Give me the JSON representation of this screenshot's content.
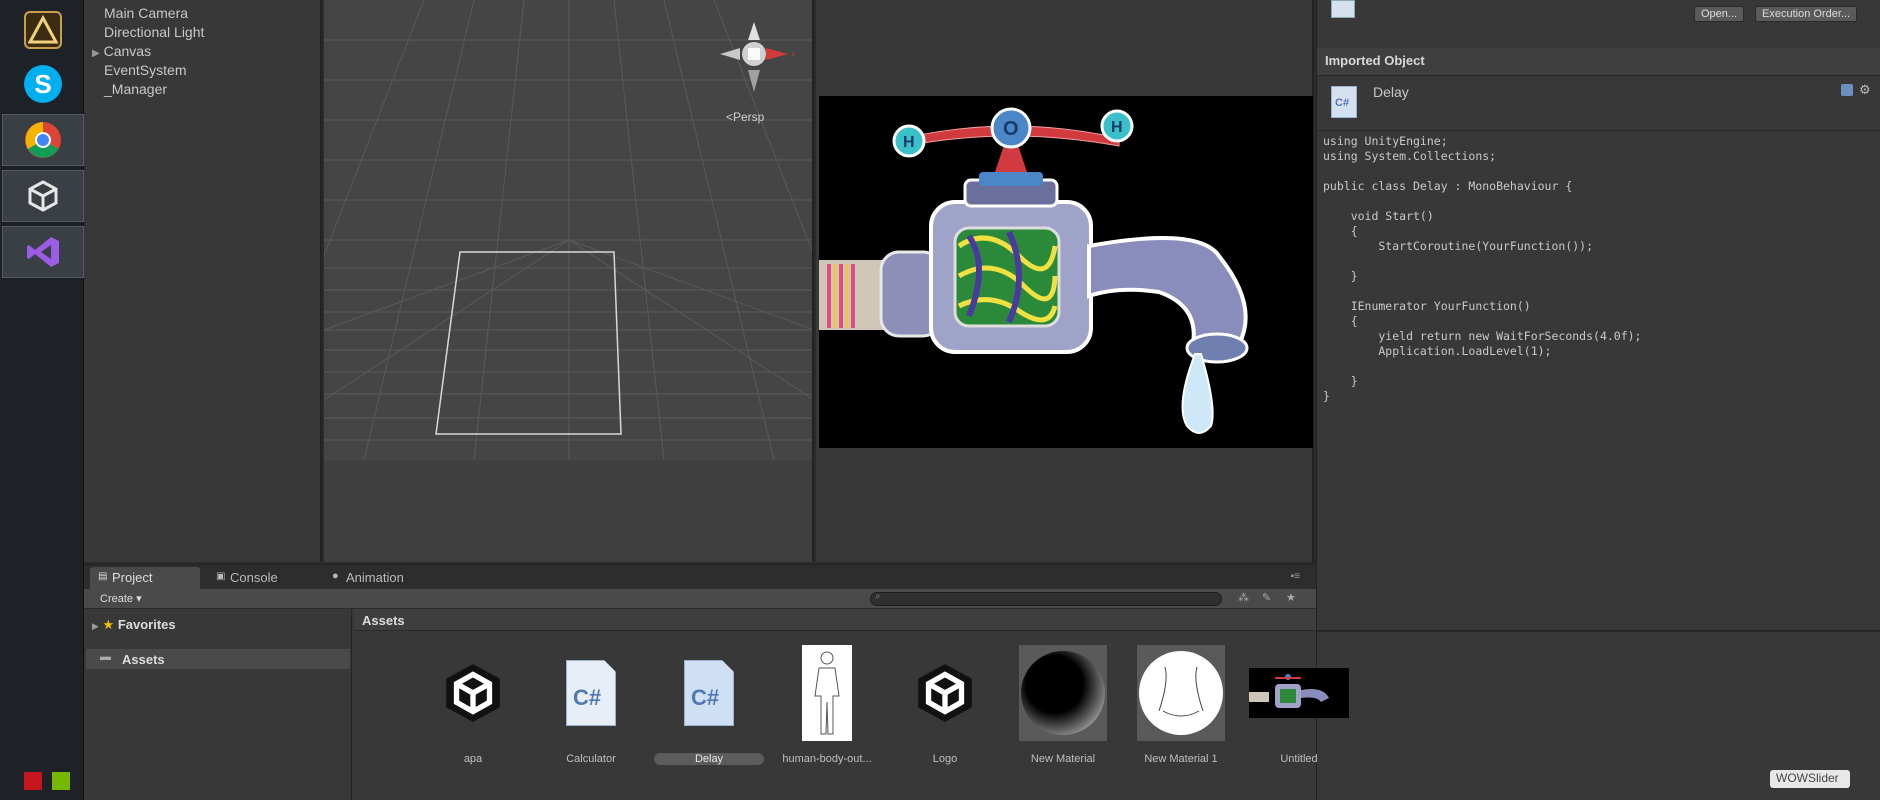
{
  "hierarchy": {
    "items": [
      {
        "label": "Main Camera",
        "expandable": false
      },
      {
        "label": "Directional Light",
        "expandable": false
      },
      {
        "label": "Canvas",
        "expandable": true
      },
      {
        "label": "EventSystem",
        "expandable": false
      },
      {
        "label": "_Manager",
        "expandable": false
      }
    ]
  },
  "scene": {
    "projection_label": "<Persp"
  },
  "inspector": {
    "open_button": "Open...",
    "execution_order_button": "Execution Order...",
    "section_title": "Imported Object",
    "object_name": "Delay",
    "file_icon_text": "C#",
    "code": "using UnityEngine;\nusing System.Collections;\n\npublic class Delay : MonoBehaviour {\n\n    void Start()\n    {\n        StartCoroutine(YourFunction());\n\n    }\n\n    IEnumerator YourFunction()\n    {\n        yield return new WaitForSeconds(4.0f);\n        Application.LoadLevel(1);\n\n    }\n}"
  },
  "project": {
    "tabs": [
      {
        "label": "Project",
        "active": true
      },
      {
        "label": "Console",
        "active": false
      },
      {
        "label": "Animation",
        "active": false
      }
    ],
    "create_label": "Create ▾",
    "favorites_label": "Favorites",
    "assets_tree_label": "Assets",
    "assets_header": "Assets",
    "assets": [
      {
        "label": "apa",
        "kind": "unity-scene"
      },
      {
        "label": "Calculator",
        "kind": "csharp-script"
      },
      {
        "label": "Delay",
        "kind": "csharp-script",
        "selected": true
      },
      {
        "label": "human-body-out...",
        "kind": "texture"
      },
      {
        "label": "Logo",
        "kind": "unity-scene"
      },
      {
        "label": "New Material",
        "kind": "material"
      },
      {
        "label": "New Material 1",
        "kind": "material"
      },
      {
        "label": "Untitled",
        "kind": "texture"
      }
    ]
  },
  "watermark": "WOWSlider",
  "colors": {
    "panel_bg": "#383838",
    "scene_bg": "#454545",
    "accent_blue": "#5079b4"
  }
}
